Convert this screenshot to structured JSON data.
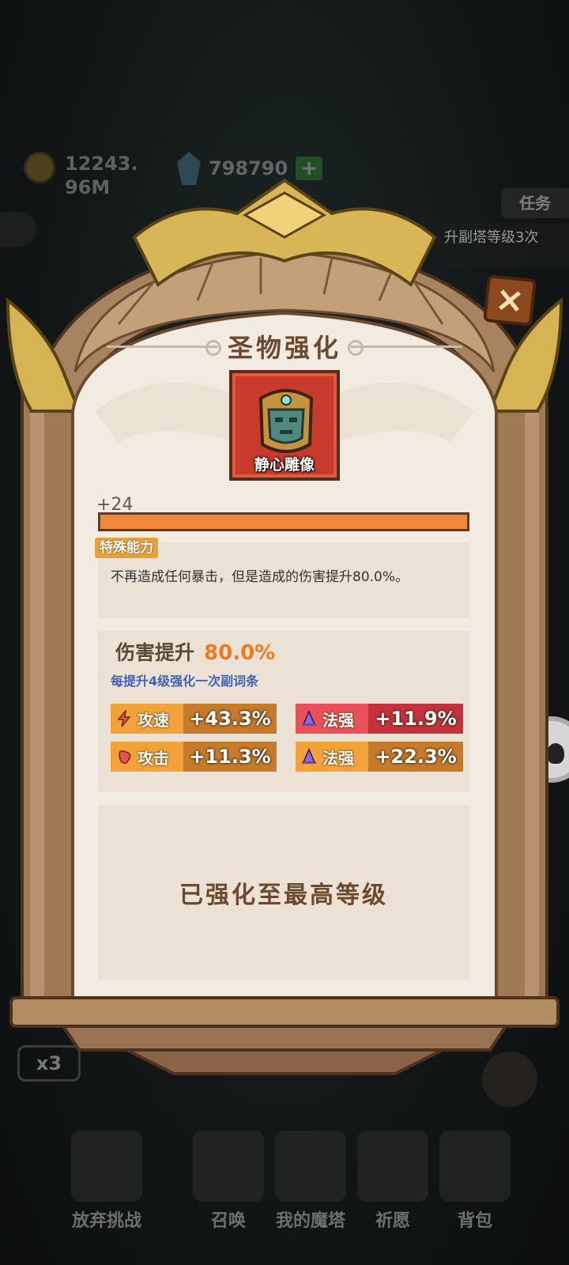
{
  "background_hud": {
    "gold_amount": "12243.\n96M",
    "gem_amount": "798790",
    "plus_label": "+",
    "task_button": "任务",
    "task_text": "升副塔等级3次",
    "speed_multiplier": "x3",
    "nav_items": [
      "放弃挑战",
      "召唤",
      "我的魔塔",
      "祈愿",
      "背包"
    ]
  },
  "dialog": {
    "title": "圣物强化",
    "close_label": "×",
    "relic": {
      "name": "静心雕像",
      "icon": "stone-statue-icon"
    },
    "level_label": "+24",
    "progress_fraction": 1.0,
    "special": {
      "tag": "特殊能力",
      "description": "不再造成任何暴击，但是造成的伤害提升80.0%。"
    },
    "damage": {
      "label": "伤害提升",
      "value": "80.0%"
    },
    "sub_note": "每提升4级强化一次副词条",
    "stats": [
      {
        "name": "攻速",
        "value": "+43.3%",
        "icon": "lightning-icon",
        "color": "orange"
      },
      {
        "name": "法强",
        "value": "+11.9%",
        "icon": "wizard-hat-icon",
        "color": "red"
      },
      {
        "name": "攻击",
        "value": "+11.3%",
        "icon": "fist-icon",
        "color": "orange"
      },
      {
        "name": "法强",
        "value": "+22.3%",
        "icon": "wizard-hat-icon",
        "color": "orange"
      }
    ],
    "max_level_text": "已强化至最高等级"
  },
  "colors": {
    "accent_orange": "#f07a24",
    "stat_orange": "#f3a23a",
    "stat_red": "#e8505a",
    "note_blue": "#3f63b8",
    "frame_gold": "#c9a24a",
    "parchment": "#f2ebe1"
  }
}
